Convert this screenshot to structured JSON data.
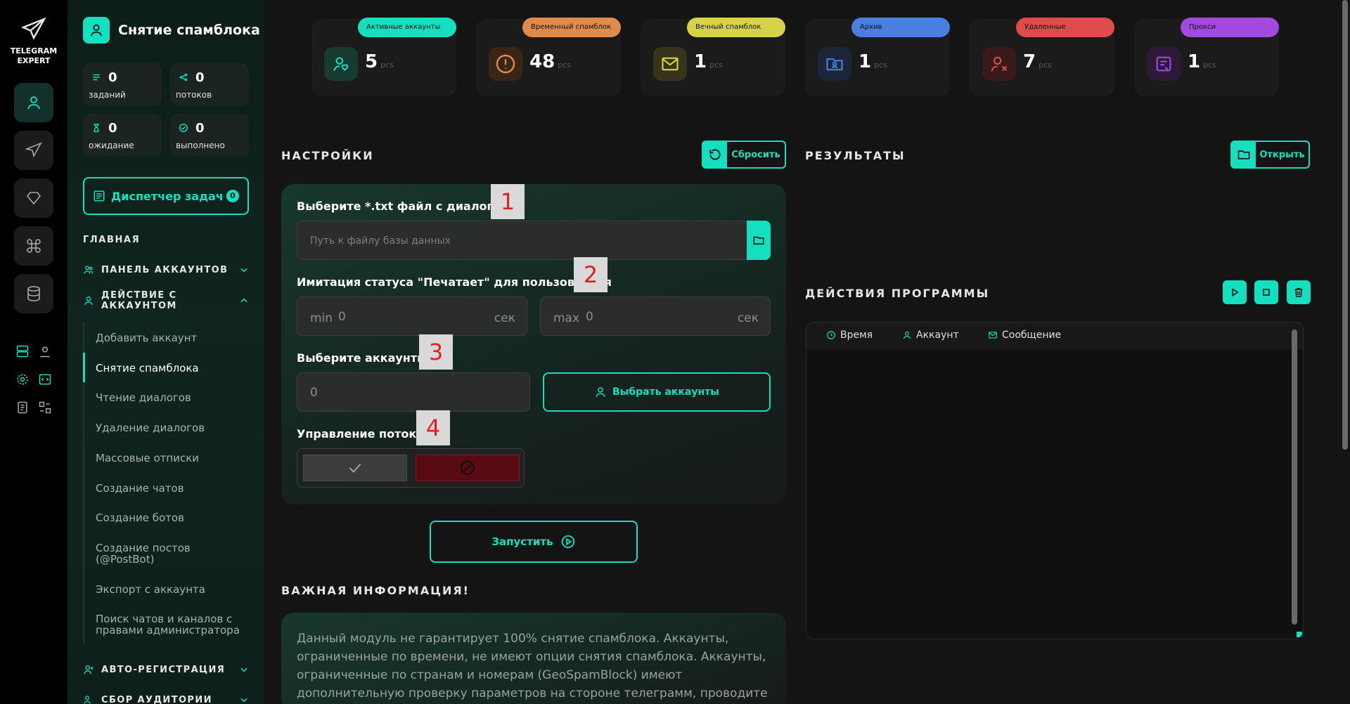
{
  "brand": {
    "line1": "TELEGRAM",
    "line2": "EXPERT"
  },
  "colors": {
    "accent": "#14e0c0",
    "danger": "#5a0a12"
  },
  "sidebar": {
    "title": "Снятие спамблока",
    "stats": [
      {
        "value": "0",
        "label": "заданий",
        "icon": "list-icon"
      },
      {
        "value": "0",
        "label": "потоков",
        "icon": "share-icon"
      },
      {
        "value": "0",
        "label": "ожидание",
        "icon": "hourglass-icon"
      },
      {
        "value": "0",
        "label": "выполнено",
        "icon": "check-circle-icon"
      }
    ],
    "dispatcher": {
      "label": "Диспетчер задач",
      "count": "0"
    },
    "section_main": "ГЛАВНАЯ",
    "menu": {
      "accounts_panel": "ПАНЕЛЬ АККАУНТОВ",
      "account_action": "ДЕЙСТВИЕ С АККАУНТОМ",
      "auto_reg": "АВТО-РЕГИСТРАЦИЯ",
      "audience": "СБОР АУДИТОРИИ"
    },
    "sub_items": [
      "Добавить аккаунт",
      "Снятие спамблока",
      "Чтение диалогов",
      "Удаление диалогов",
      "Массовые отписки",
      "Создание чатов",
      "Создание ботов",
      "Создание постов (@PostBot)",
      "Экспорт с аккаунта",
      "Поиск чатов и каналов с правами администратора"
    ]
  },
  "cards": [
    {
      "badge": "Активные аккаунты",
      "value": "5",
      "unit": "pcs",
      "badge_color": "#14e0c0",
      "icon": "user-heart-icon"
    },
    {
      "badge": "Временный спамблок",
      "value": "48",
      "unit": "pcs",
      "badge_color": "#e08a4c",
      "icon": "alert-circle-icon"
    },
    {
      "badge": "Вечный спамблок",
      "value": "1",
      "unit": "pcs",
      "badge_color": "#d8d24a",
      "icon": "mail-blocked-icon"
    },
    {
      "badge": "Архив",
      "value": "1",
      "unit": "pcs",
      "badge_color": "#4a7fe0",
      "icon": "archive-user-icon"
    },
    {
      "badge": "Удаленные",
      "value": "7",
      "unit": "pcs",
      "badge_color": "#e04a4a",
      "icon": "user-x-icon"
    },
    {
      "badge": "Прокси",
      "value": "1",
      "unit": "pcs",
      "badge_color": "#a24ae0",
      "icon": "proxy-icon"
    }
  ],
  "settings": {
    "heading": "НАСТРОЙКИ",
    "reset": "Сбросить",
    "file_label": "Выберите *.txt файл с диалогами",
    "file_placeholder": "Путь к файлу базы данных",
    "typing_label": "Имитация статуса \"Печатает\" для пользователя",
    "min_label": "min",
    "min_value": "0",
    "min_unit": "сек",
    "max_label": "max",
    "max_value": "0",
    "max_unit": "сек",
    "accounts_label": "Выберите аккаунты",
    "accounts_value": "0",
    "select_accounts": "Выбрать аккаунты",
    "threads_label": "Управление потоками",
    "tags": [
      "1",
      "2",
      "3",
      "4"
    ]
  },
  "launch": "Запустить",
  "info": {
    "heading": "ВАЖНАЯ ИНФОРМАЦИЯ!",
    "text": "Данный модуль не гарантирует 100% снятие спамблока. Аккаунты, ограниченные по времени, не имеют опции снятия спамблока. Аккаунты, ограниченные по странам и номерам (GeoSpamBlock) имеют дополнительную проверку параметров на стороне телеграмм, проводите тесты перед"
  },
  "results": {
    "heading": "РЕЗУЛЬТАТЫ",
    "open": "Открыть"
  },
  "actions": {
    "heading": "ДЕЙСТВИЯ ПРОГРАММЫ",
    "columns": [
      "Время",
      "Аккаунт",
      "Сообщение"
    ]
  }
}
